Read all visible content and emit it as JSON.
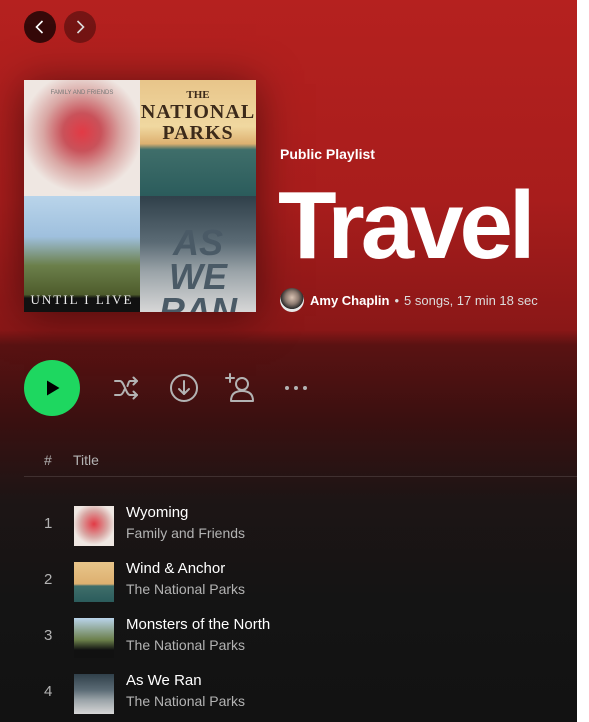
{
  "nav": {
    "back_icon": "chevron-left-icon",
    "forward_icon": "chevron-right-icon"
  },
  "playlist": {
    "type_label": "Public Playlist",
    "title": "Travel",
    "owner": "Amy Chaplin",
    "separator": "•",
    "stats": "5 songs, 17 min 18 sec",
    "cover_tiles": [
      {
        "text_lines": [
          "FAMILY AND FRIENDS"
        ]
      },
      {
        "text_lines": [
          "THE",
          "NATIONAL",
          "PARKS"
        ]
      },
      {
        "text_lines": [
          "UNTIL I LIVE"
        ]
      },
      {
        "text_lines": [
          "AS WE",
          "RAN"
        ]
      }
    ]
  },
  "actions": {
    "play_icon": "play-icon",
    "shuffle_icon": "shuffle-icon",
    "download_icon": "download-icon",
    "add_user_icon": "add-user-icon",
    "more_icon": "more-icon"
  },
  "colors": {
    "accent": "#1ed760",
    "header": "#b5211f",
    "background": "#121212"
  },
  "tracklist": {
    "header": {
      "number": "#",
      "title": "Title"
    },
    "tracks": [
      {
        "number": "1",
        "title": "Wyoming",
        "artist": "Family and Friends"
      },
      {
        "number": "2",
        "title": "Wind & Anchor",
        "artist": "The National Parks"
      },
      {
        "number": "3",
        "title": "Monsters of the North",
        "artist": "The National Parks"
      },
      {
        "number": "4",
        "title": "As We Ran",
        "artist": "The National Parks"
      }
    ]
  }
}
